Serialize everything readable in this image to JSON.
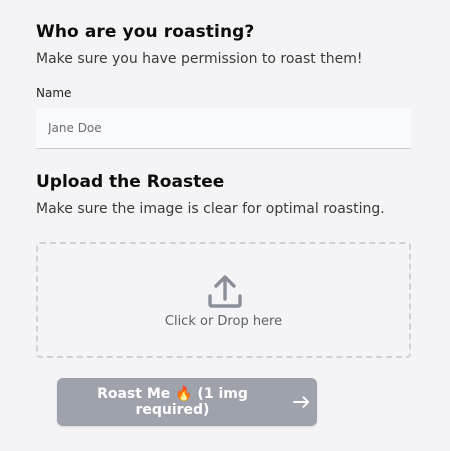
{
  "roastee": {
    "title": "Who are you roasting?",
    "subtitle": "Make sure you have permission to roast them!",
    "name_label": "Name",
    "name_placeholder": "Jane Doe",
    "name_value": ""
  },
  "upload": {
    "title": "Upload the Roastee",
    "subtitle": "Make sure the image is clear for optimal roasting.",
    "dropzone_text": "Click or Drop here",
    "icon": "upload-icon"
  },
  "submit": {
    "label": "Roast Me 🔥 (1 img required)",
    "icon": "arrow-right-icon",
    "disabled": true
  },
  "colors": {
    "background": "#f4f4f6",
    "button_disabled": "#9ea2ab",
    "dropzone_border": "#cfd1d6"
  }
}
